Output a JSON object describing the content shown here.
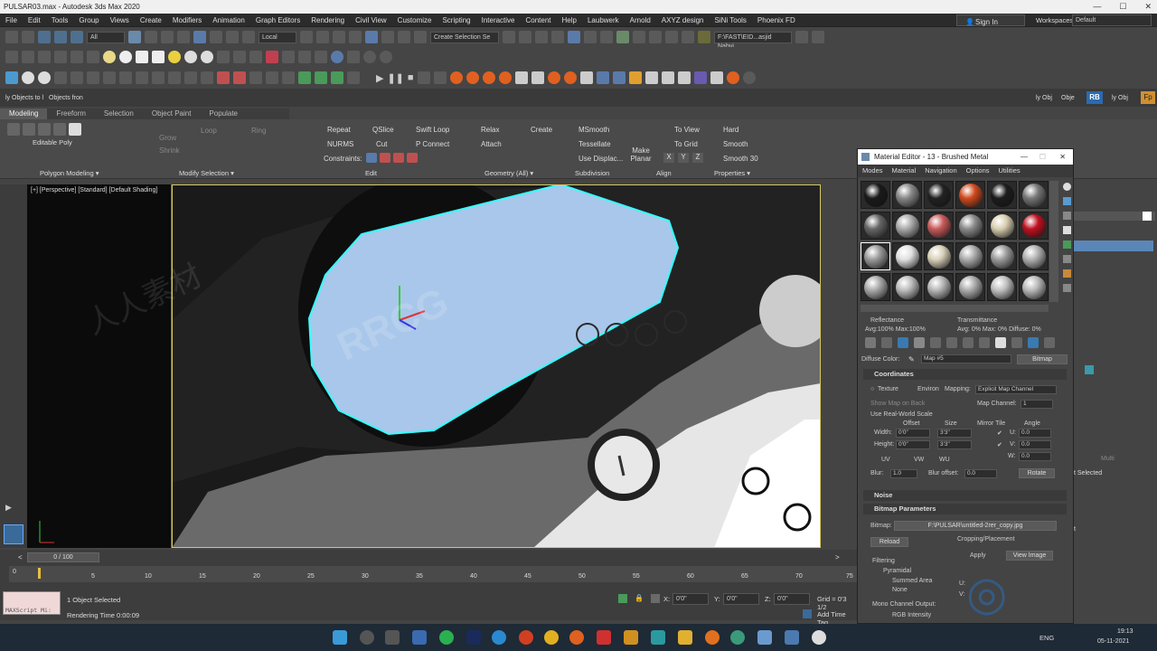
{
  "app": {
    "title": "PULSAR03.max - Autodesk 3ds Max 2020"
  },
  "menu": [
    "File",
    "Edit",
    "Tools",
    "Group",
    "Views",
    "Create",
    "Modifiers",
    "Animation",
    "Graph Editors",
    "Rendering",
    "Civil View",
    "Customize",
    "Scripting",
    "Interactive",
    "Content",
    "Help",
    "Laubwerk",
    "Arnold",
    "AXYZ design",
    "SiNi Tools",
    "Phoenix FD"
  ],
  "signin": {
    "label": "Sign In"
  },
  "workspaces": {
    "label": "Workspaces:",
    "value": "Default"
  },
  "toolbar": {
    "filter_dropdown": "All",
    "refcoord": "Local",
    "selection_set": "Create Selection Se",
    "path": "F:\\FAST\\EID...asjid Nabvi"
  },
  "scene_explorer": {
    "objects_to_1": "ly Objects to l",
    "objects_from": "Objects fron",
    "obj_a": "ly Obj",
    "obj_b": "Obje",
    "obj_c": "ly Obj"
  },
  "ribbon": {
    "tabs": [
      "Modeling",
      "Freeform",
      "Selection",
      "Object Paint",
      "Populate"
    ],
    "active_tab": "Modeling",
    "editable_poly": "Editable Poly",
    "grow": "Grow",
    "shrink": "Shrink",
    "loop": "Loop",
    "ring": "Ring",
    "repeat": "Repeat",
    "nurms": "NURMS",
    "constraints": "Constraints:",
    "qslice": "QSlice",
    "cut": "Cut",
    "swift_loop": "Swift Loop",
    "p_connect": "P Connect",
    "relax": "Relax",
    "attach": "Attach",
    "create": "Create",
    "msmooth": "MSmooth",
    "tessellate": "Tessellate",
    "use_displace": "Use Displac...",
    "make_planar": "Make Planar",
    "to_view": "To View",
    "to_grid": "To Grid",
    "xyz": [
      "X",
      "Y",
      "Z"
    ],
    "hard": "Hard",
    "smooth": "Smooth",
    "smooth30": "Smooth 30",
    "groups": {
      "polygon_modeling": "Polygon Modeling ▾",
      "modify_selection": "Modify Selection ▾",
      "edit": "Edit",
      "geometry": "Geometry (All) ▾",
      "subdivision": "Subdivision",
      "align": "Align",
      "properties": "Properties ▾"
    }
  },
  "viewport": {
    "label": "[+] [Perspective] [Standard] [Default Shading]"
  },
  "timeline": {
    "frame": "0 / 100",
    "ticks": [
      "0",
      "5",
      "10",
      "15",
      "20",
      "25",
      "30",
      "35",
      "40",
      "45",
      "50",
      "55",
      "60",
      "65",
      "70",
      "75"
    ]
  },
  "status": {
    "maxscript": "MAXScript Mi:",
    "selected": "1 Object Selected",
    "render_time": "Rendering Time  0:00:09",
    "x": "0'0\"",
    "y": "0'0\"",
    "z": "0'0\"",
    "grid": "Grid = 0'3 1/2",
    "add_time_tag": "Add Time Tag"
  },
  "material_editor": {
    "title": "Material Editor - 13 - Brushed Metal",
    "menu": [
      "Modes",
      "Material",
      "Navigation",
      "Options",
      "Utilities"
    ],
    "reflectance_label": "Reflectance",
    "reflectance_value": "Avg:100% Max:100%",
    "transmittance_label": "Transmittance",
    "transmittance_value": "Avg:   0% Max:   0%  Diffuse:  0%",
    "diffuse_color": "Diffuse Color:",
    "map_name": "Map #5",
    "map_type": "Bitmap",
    "coordinates": {
      "header": "Coordinates",
      "texture": "Texture",
      "environ": "Environ",
      "mapping_label": "Mapping:",
      "mapping_value": "Explicit Map Channel",
      "show_map": "Show Map on Back",
      "map_channel_label": "Map Channel:",
      "map_channel_value": "1",
      "real_world": "Use Real-World Scale",
      "offset": "Offset",
      "size": "Size",
      "mirror_tile": "Mirror Tile",
      "angle": "Angle",
      "width_label": "Width:",
      "width_offset": "0'0\"",
      "width_size": "3'3\"",
      "height_label": "Height:",
      "height_offset": "0'0\"",
      "height_size": "3'3\"",
      "u_label": "U:",
      "u_value": "0.0",
      "v_label": "V:",
      "v_value": "0.0",
      "w_label": "W:",
      "w_value": "0.0",
      "uv": "UV",
      "vw": "VW",
      "wu": "WU",
      "blur_label": "Blur:",
      "blur_value": "1.0",
      "blur_offset_label": "Blur offset:",
      "blur_offset_value": "0.0",
      "rotate": "Rotate"
    },
    "noise": "Noise",
    "bitmap_params": {
      "header": "Bitmap Parameters",
      "bitmap_label": "Bitmap:",
      "bitmap_path": "F:\\PULSAR\\untitled-2rer_copy.jpg",
      "reload": "Reload",
      "cropping": "Cropping/Placement",
      "apply": "Apply",
      "view_image": "View Image",
      "filtering": "Filtering",
      "pyramidal": "Pyramidal",
      "summed_area": "Summed Area",
      "none": "None",
      "mono_output": "Mono Channel Output:",
      "rgb_intensity": "RGB Intensity",
      "u_short": "U:",
      "v_short": "V:"
    },
    "slot_colors": [
      "#1a1a1a",
      "#888888",
      "#222222",
      "#d04a1e",
      "#1c1c1c",
      "#777777",
      "#666666",
      "#aaaaaa",
      "#c85a5a",
      "#8a8a8a",
      "#d8cdb0",
      "#c01020",
      "#999999",
      "#e0e0e0",
      "#d8d0b8",
      "#aaaaaa",
      "#9a9a9a",
      "#b0b0b0",
      "#a8a8a8",
      "#bbbbbb",
      "#b5b5b5",
      "#aaaaaa",
      "#c0c0c0",
      "#b8b8b8"
    ]
  },
  "command_panel": {
    "multi": "Multi",
    "selected": "t Selected",
    "t_label": "t"
  },
  "taskbar": {
    "lang": "ENG",
    "time": "19:13",
    "date": "05-11-2021"
  },
  "watermark": {
    "brand": "RRCG",
    "cn": "人人素材"
  }
}
